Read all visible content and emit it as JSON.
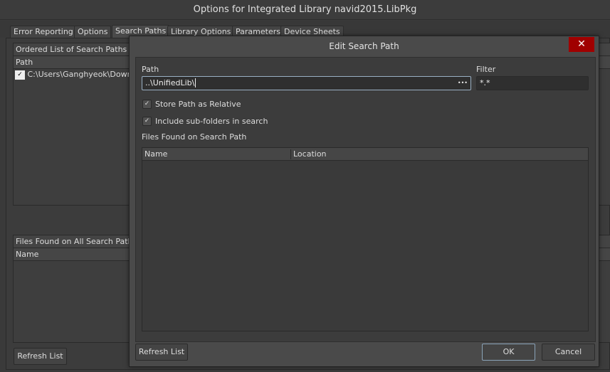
{
  "window": {
    "title": "Options for Integrated Library navid2015.LibPkg"
  },
  "tabs": [
    {
      "label": "Error Reporting"
    },
    {
      "label": "Options"
    },
    {
      "label": "Search Paths"
    },
    {
      "label": "Library Options"
    },
    {
      "label": "Parameters"
    },
    {
      "label": "Device Sheets"
    }
  ],
  "search_paths": {
    "group_title": "Ordered List of Search Paths",
    "column": "Path",
    "rows": [
      {
        "path": "C:\\Users\\Ganghyeok\\Downloads"
      }
    ]
  },
  "files_all": {
    "group_title": "Files Found on All Search Paths",
    "column": "Name",
    "refresh_label": "Refresh List"
  },
  "dialog": {
    "title": "Edit Search Path",
    "close_glyph": "✕",
    "path_label": "Path",
    "path_value": "..\\UnifiedLib\\",
    "browse_glyph": "•••",
    "filter_label": "Filter",
    "filter_value": "*.*",
    "store_relative": {
      "label": "Store Path as Relative",
      "checked": true
    },
    "include_sub": {
      "label": "Include sub-folders in search",
      "checked": true
    },
    "files_title": "Files Found on Search Path",
    "columns": [
      "Name",
      "Location"
    ],
    "refresh_label": "Refresh List",
    "ok_label": "OK",
    "cancel_label": "Cancel",
    "check_glyph": "✓"
  }
}
